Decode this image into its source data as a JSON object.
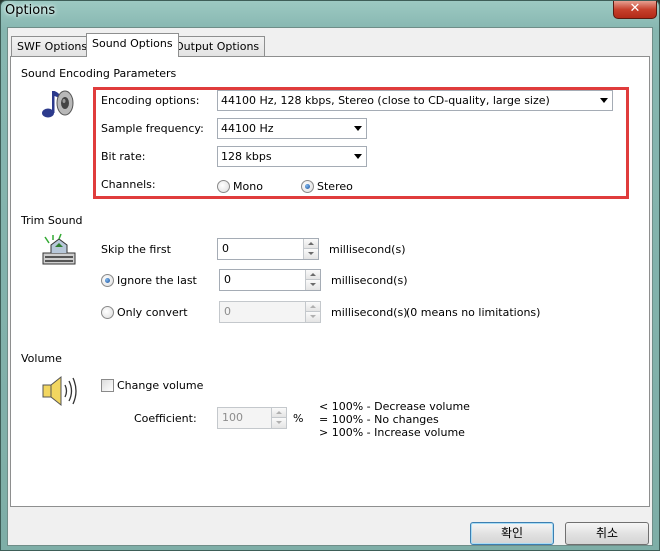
{
  "window": {
    "title": "Options",
    "close_label": "✕"
  },
  "tabs": [
    {
      "label": "SWF Options",
      "active": false
    },
    {
      "label": "Sound Options",
      "active": true
    },
    {
      "label": "Output Options",
      "active": false
    }
  ],
  "encoding": {
    "group_title": "Sound Encoding Parameters",
    "encoding_label": "Encoding options:",
    "encoding_value": "44100 Hz, 128 kbps, Stereo (close to CD-quality, large size)",
    "sample_label": "Sample frequency:",
    "sample_value": "44100 Hz",
    "bitrate_label": "Bit rate:",
    "bitrate_value": "128 kbps",
    "channels_label": "Channels:",
    "mono_label": "Mono",
    "stereo_label": "Stereo",
    "selected_channel": "Stereo"
  },
  "trim": {
    "group_title": "Trim Sound",
    "skip_label": "Skip the first",
    "skip_value": "0",
    "ignore_label": "Ignore the last",
    "ignore_value": "0",
    "only_label": "Only convert",
    "only_value": "0",
    "unit_ms": "millisecond(s)",
    "no_limit_note": "(0 means no limitations)",
    "selected_option": "Ignore the last"
  },
  "volume": {
    "group_title": "Volume",
    "change_label": "Change volume",
    "change_checked": false,
    "coefficient_label": "Coefficient:",
    "coefficient_value": "100",
    "percent_sign": "%",
    "legend": [
      "< 100% - Decrease volume",
      "= 100% - No changes",
      "> 100% - Increase volume"
    ]
  },
  "buttons": {
    "ok_label": "확인",
    "cancel_label": "취소"
  },
  "colors": {
    "highlight": "#e03c3c",
    "titlebar": "#86b6b0",
    "close": "#c7402c"
  }
}
